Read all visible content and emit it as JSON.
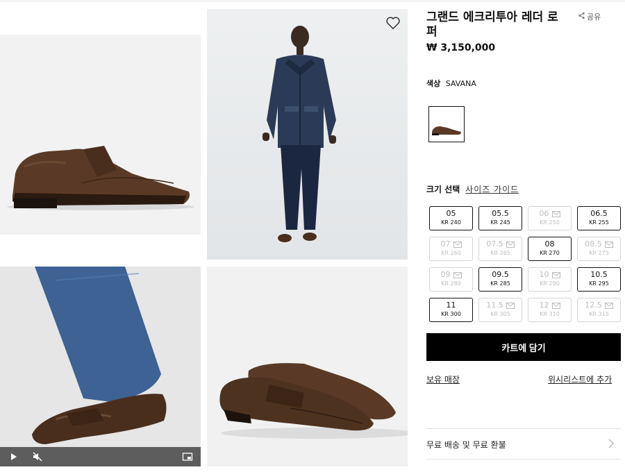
{
  "product": {
    "title": "그랜드 에크리투아 레더 로퍼",
    "price": "₩ 3,150,000",
    "share_label": "공유",
    "color_label": "색상",
    "color_value": "SAVANA"
  },
  "size": {
    "label": "크기 선택",
    "guide": "사이즈 가이드",
    "options": [
      {
        "eu": "05",
        "kr": "KR 240",
        "available": true
      },
      {
        "eu": "05.5",
        "kr": "KR 245",
        "available": true
      },
      {
        "eu": "06",
        "kr": "KR 250",
        "available": false
      },
      {
        "eu": "06.5",
        "kr": "KR 255",
        "available": true
      },
      {
        "eu": "07",
        "kr": "KR 260",
        "available": false
      },
      {
        "eu": "07.5",
        "kr": "KR 265",
        "available": false
      },
      {
        "eu": "08",
        "kr": "KR 270",
        "available": true
      },
      {
        "eu": "08.5",
        "kr": "KR 275",
        "available": false
      },
      {
        "eu": "09",
        "kr": "KR 280",
        "available": false
      },
      {
        "eu": "09.5",
        "kr": "KR 285",
        "available": true
      },
      {
        "eu": "10",
        "kr": "KR 290",
        "available": false
      },
      {
        "eu": "10.5",
        "kr": "KR 295",
        "available": true
      },
      {
        "eu": "11",
        "kr": "KR 300",
        "available": true
      },
      {
        "eu": "11.5",
        "kr": "KR 305",
        "available": false
      },
      {
        "eu": "12",
        "kr": "KR 310",
        "available": false
      },
      {
        "eu": "12.5",
        "kr": "KR 315",
        "available": false
      }
    ]
  },
  "actions": {
    "cart": "카트에 담기",
    "store": "보유 매장",
    "wishlist": "위시리스트에 추가"
  },
  "accordion": {
    "shipping": "무료 배송 및 무료 환불"
  },
  "icons": {
    "heart": "heart-icon",
    "share": "share-icon",
    "play": "play-icon",
    "mute": "mute-icon",
    "pip": "picture-in-picture-icon",
    "mail": "mail-icon",
    "chevron": "chevron-right-icon"
  },
  "colors": {
    "leather": "#5a3a26",
    "black": "#000000",
    "muted": "#bdbdbd"
  }
}
